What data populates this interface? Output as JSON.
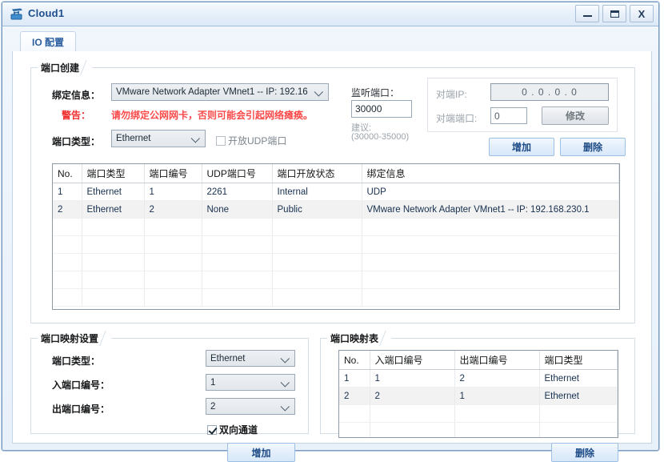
{
  "window": {
    "title": "Cloud1",
    "icon": "cloud-device-icon",
    "controls": {
      "minimize": "minimize-icon",
      "maximize": "maximize-icon",
      "close": "X"
    }
  },
  "tabs": [
    {
      "label": "IO 配置",
      "active": true
    }
  ],
  "port_create": {
    "title": "端口创建",
    "binding_label": "绑定信息：",
    "binding_value": "VMware Network Adapter VMnet1 -- IP: 192.16",
    "warning_key": "警告：",
    "warning_text": "请勿绑定公网网卡，否则可能会引起网络瘫痪。",
    "port_type_label": "端口类型：",
    "port_type_value": "Ethernet",
    "udp_checkbox_label": "开放UDP端口",
    "udp_checked": false,
    "listen_port_label": "监听端口：",
    "listen_port_value": "30000",
    "suggest_label": "建议:",
    "suggest_range": "(30000-35000)",
    "peer_ip_label": "对端IP:",
    "peer_ip_value": "0 . 0 . 0 . 0",
    "peer_port_label": "对端端口:",
    "peer_port_value": "0",
    "modify_button": "修改",
    "add_button": "增加",
    "delete_button": "删除"
  },
  "port_table": {
    "headers": [
      "No.",
      "端口类型",
      "端口编号",
      "UDP端口号",
      "端口开放状态",
      "绑定信息"
    ],
    "rows": [
      [
        "1",
        "Ethernet",
        "1",
        "2261",
        "Internal",
        "UDP"
      ],
      [
        "2",
        "Ethernet",
        "2",
        "None",
        "Public",
        "VMware Network Adapter VMnet1 -- IP: 192.168.230.1"
      ]
    ],
    "empty_rows": 5
  },
  "mapping_settings": {
    "title": "端口映射设置",
    "port_type_label": "端口类型：",
    "port_type_value": "Ethernet",
    "in_port_label": "入端口编号：",
    "in_port_value": "1",
    "out_port_label": "出端口编号：",
    "out_port_value": "2",
    "bidirectional_label": "双向通道",
    "bidirectional_checked": true,
    "add_button": "增加"
  },
  "mapping_table": {
    "title": "端口映射表",
    "headers": [
      "No.",
      "入端口编号",
      "出端口编号",
      "端口类型"
    ],
    "rows": [
      [
        "1",
        "1",
        "2",
        "Ethernet"
      ],
      [
        "2",
        "2",
        "1",
        "Ethernet"
      ]
    ],
    "empty_rows": 3,
    "delete_button": "删除"
  },
  "colors": {
    "title_text": "#1f4e8c",
    "warning": "#fa4a4a",
    "tab_text": "#2b5fa0",
    "button_blue": "#1d4b86",
    "cell_text": "#17304f"
  }
}
